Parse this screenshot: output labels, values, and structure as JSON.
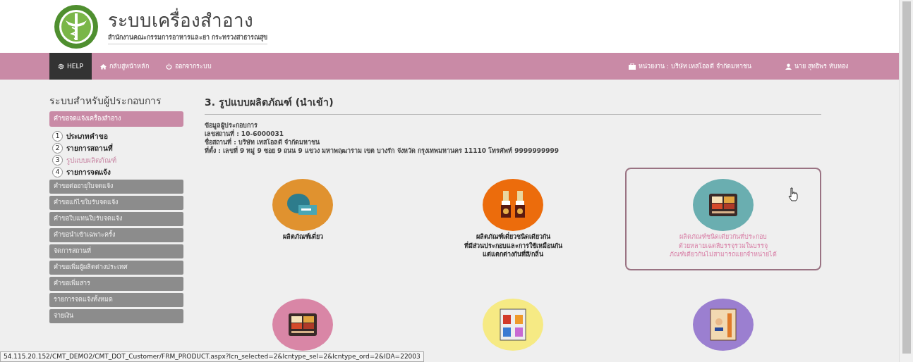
{
  "header": {
    "title": "ระบบเครื่องสำอาง",
    "subtitle": "สำนักงานคณะกรรมการอาหารและยา กระทรวงสาธารณสุข"
  },
  "navbar": {
    "left": [
      {
        "kind": "help",
        "label": "HELP",
        "selected": true
      },
      {
        "kind": "home",
        "label": "กลับสู่หน้าหลัก",
        "selected": false
      },
      {
        "kind": "logout",
        "label": "ออกจากระบบ",
        "selected": false
      }
    ],
    "right": [
      {
        "kind": "office",
        "label": "หน่วยงาน : บริษัท เทสโอลดี จำกัดมหาชน"
      },
      {
        "kind": "user",
        "label": "นาย สุทธิพร ทับทอง"
      }
    ]
  },
  "sidebar": {
    "title": "ระบบสำหรับผู้ประกอบการ",
    "items": [
      {
        "label": "คำขอจดแจ้งเครื่องสำอาง",
        "selected": true
      },
      {
        "label": "คำขอต่ออายุใบจดแจ้ง",
        "selected": false
      },
      {
        "label": "คำขอแก้ไขใบรับจดแจ้ง",
        "selected": false
      },
      {
        "label": "คำขอใบแทนใบรับจดแจ้ง",
        "selected": false
      },
      {
        "label": "คำขอนำเข้าเฉพาะครั้ง",
        "selected": false
      },
      {
        "label": "จัดการสถานที่",
        "selected": false
      },
      {
        "label": "คำขอเพิ่มผู้ผลิตต่างประเทศ",
        "selected": false
      },
      {
        "label": "คำขอเพิ่มสาร",
        "selected": false
      },
      {
        "label": "รายการจดแจ้งทั้งหมด",
        "selected": false
      },
      {
        "label": "จ่ายเงิน",
        "selected": false
      }
    ],
    "steps": [
      {
        "number": "1",
        "label": "ประเภทคำขอ",
        "selected": false
      },
      {
        "number": "2",
        "label": "รายการสถานที่",
        "selected": false
      },
      {
        "number": "3",
        "label": "รูปแบบผลิตภัณฑ์",
        "selected": true
      },
      {
        "number": "4",
        "label": "รายการจดแจ้ง",
        "selected": false
      }
    ]
  },
  "content": {
    "heading": "3. รูปแบบผลิตภัณฑ์ (นำเข้า)",
    "info": [
      "ข้อมูลผู้ประกอบการ",
      "เลขสถานที่ : 10-6000031",
      "ชื่อสถานที่ : บริษัท เทสโอลดี จำกัดมหาชน",
      "ที่ตั้ง : เลขที่ 9 หมู่ 9 ซอย 9 ถนน 9 แขวง มหาพฤฒาราม เขต บางรัก จังหวัด กรุงเทพมหานคร 11110 โทรศัพท์ 9999999999"
    ],
    "products": [
      {
        "kind": "compact",
        "color": "#e0922f",
        "hovered": false,
        "lines": [
          "ผลิตภัณฑ์เดี่ยว"
        ]
      },
      {
        "kind": "lipstick",
        "color": "#ec6c0c",
        "hovered": false,
        "lines": [
          "ผลิตภัณฑ์เดี่ยวชนิดเดียวกัน",
          "ที่มีส่วนประกอบและการใช้เหมือนกัน",
          "แต่แตกต่างกันที่สี/กลิ่น"
        ]
      },
      {
        "kind": "palette",
        "color": "#6aaeb0",
        "hovered": true,
        "lines": [
          "ผลิตภัณฑ์ชนิดเดียวกันที่ประกอบ",
          "ด้วยหลายเฉดสีบรรจุรวมในบรรจุ",
          "ภัณฑ์เดียวกันไม่สามารถแยกจำหน่ายได้"
        ]
      },
      {
        "kind": "palette",
        "color": "#d986a6",
        "hovered": false
      },
      {
        "kind": "bottles",
        "color": "#f6ea84",
        "hovered": false
      },
      {
        "kind": "pencil",
        "color": "#9b7fd0",
        "hovered": false
      }
    ]
  },
  "status_bar": {
    "url": "54.115.20.152/CMT_DEMO2/CMT_DOT_Customer/FRM_PRODUCT.aspx?lcn_selected=2&lcntype_sel=2&lcntype_ord=2&IDA=22003"
  }
}
